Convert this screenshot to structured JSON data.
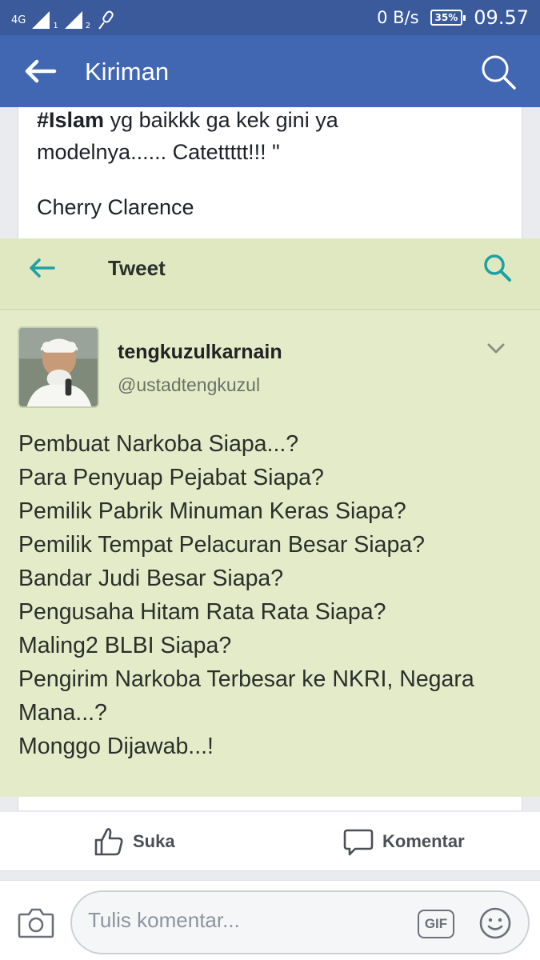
{
  "status_bar": {
    "network_type": "4G",
    "sim1": "1",
    "sim2": "2",
    "data_rate": "0 B/s",
    "battery": "35%",
    "time": "09.57"
  },
  "app_bar": {
    "title": "Kiriman",
    "back_icon": "arrow-left-icon",
    "search_icon": "search-icon"
  },
  "post": {
    "text_hashtag": "#Islam",
    "text_line1_rest": " yg baikkk ga kek gini ya",
    "text_line2": "modelnya...... Catettttt!!! \"",
    "author": "Cherry Clarence"
  },
  "tweet": {
    "header_title": "Tweet",
    "name": "tengkuzulkarnain",
    "handle": "@ustadtengkuzul",
    "lines": [
      "Pembuat Narkoba Siapa...?",
      "Para Penyuap Pejabat Siapa?",
      "Pemilik Pabrik Minuman Keras Siapa?",
      "Pemilik Tempat Pelacuran Besar Siapa?",
      "Bandar Judi Besar Siapa?",
      "Pengusaha Hitam Rata Rata Siapa?",
      "Maling2 BLBI Siapa?",
      "Pengirim Narkoba Terbesar ke NKRI, Negara",
      "Mana...?",
      "Monggo Dijawab...!"
    ]
  },
  "actions": {
    "like_label": "Suka",
    "comment_label": "Komentar"
  },
  "composer": {
    "placeholder": "Tulis komentar...",
    "gif_label": "GIF"
  },
  "colors": {
    "status_bar": "#3a5a9b",
    "app_bar": "#4267b2",
    "tweet_bg": "#e4ebc8",
    "tweet_accent": "#1da1a1"
  }
}
